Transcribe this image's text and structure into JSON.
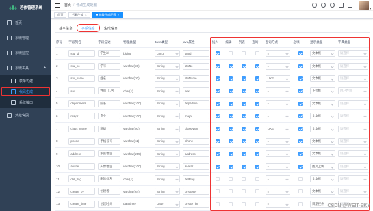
{
  "app": {
    "title": "若依管理系统"
  },
  "sidebar": {
    "items": [
      {
        "label": "首页",
        "icon": "dashboard-icon"
      },
      {
        "label": "系统管理",
        "icon": "system-icon"
      },
      {
        "label": "系统监控",
        "icon": "monitor-icon"
      },
      {
        "label": "系统工具",
        "icon": "tool-icon",
        "open": true,
        "children": [
          {
            "label": "表单构建",
            "icon": "build-icon"
          },
          {
            "label": "代码生成",
            "icon": "code-icon",
            "active": true
          },
          {
            "label": "系统接口",
            "icon": "swagger-icon"
          }
        ]
      },
      {
        "label": "若依官网",
        "icon": "guide-icon"
      }
    ]
  },
  "breadcrumb": {
    "home": "首页",
    "sep": "/",
    "current": "修改生成配置"
  },
  "tags": [
    {
      "label": "首页"
    },
    {
      "label": "代码生成",
      "closable": true
    },
    {
      "label": "修改生成配置",
      "closable": true,
      "active": true
    }
  ],
  "tabs": [
    {
      "label": "基本信息"
    },
    {
      "label": "字段信息",
      "active": true
    },
    {
      "label": "生成信息"
    }
  ],
  "table": {
    "headers": [
      "序号",
      "字段列名",
      "字段描述",
      "物理类型",
      "Java类型",
      "java属性",
      "插入",
      "编辑",
      "列表",
      "查询",
      "查询方式",
      "必填",
      "显示类型",
      "字典类型"
    ],
    "rows": [
      [
        "1",
        "stu_id",
        "学生id",
        "bigint",
        "Long",
        "stuId",
        true,
        false,
        false,
        false,
        "=",
        true,
        "文本框",
        "请选择"
      ],
      [
        "2",
        "stu_no",
        "学号",
        "varchar(30)",
        "String",
        "stuNo",
        true,
        true,
        true,
        true,
        "=",
        true,
        "文本框",
        "请选择"
      ],
      [
        "3",
        "stu_name",
        "姓名",
        "varchar(30)",
        "String",
        "stuName",
        true,
        true,
        true,
        true,
        "LIKE",
        true,
        "文本框",
        "请选择"
      ],
      [
        "4",
        "sex",
        "性别（1男",
        "char(1)",
        "String",
        "sex",
        true,
        true,
        true,
        true,
        "=",
        true,
        "下拉框",
        "用户性别"
      ],
      [
        "5",
        "department",
        "院系",
        "varchar(100)",
        "String",
        "departme",
        true,
        true,
        true,
        true,
        "=",
        true,
        "文本框",
        "请选择"
      ],
      [
        "6",
        "major",
        "专业",
        "varchar(100)",
        "String",
        "major",
        true,
        true,
        true,
        true,
        "=",
        true,
        "文本框",
        "请选择"
      ],
      [
        "7",
        "class_name",
        "班级",
        "varchar(50)",
        "String",
        "classNam",
        true,
        true,
        true,
        true,
        "LIKE",
        true,
        "文本框",
        "请选择"
      ],
      [
        "8",
        "phone",
        "手机号码",
        "varchar(11)",
        "String",
        "phone",
        true,
        true,
        true,
        true,
        "=",
        true,
        "文本框",
        "请选择"
      ],
      [
        "9",
        "address",
        "家庭地址",
        "varchar(255)",
        "String",
        "address",
        true,
        true,
        true,
        true,
        "=",
        true,
        "文本框",
        "请选择"
      ],
      [
        "10",
        "avatar",
        "头像地址",
        "varchar(100)",
        "String",
        "avatar",
        true,
        true,
        true,
        true,
        "=",
        true,
        "图片上传",
        "请选择"
      ],
      [
        "11",
        "del_flag",
        "删除标志",
        "char(1)",
        "String",
        "delFlag",
        false,
        false,
        false,
        false,
        "=",
        false,
        "文本框",
        "请选择"
      ],
      [
        "12",
        "create_by",
        "创建者",
        "varchar(64)",
        "String",
        "createBy",
        false,
        false,
        false,
        false,
        "=",
        false,
        "文本框",
        "请选择"
      ],
      [
        "13",
        "create_time",
        "创建时间",
        "datetime",
        "Date",
        "createTim",
        false,
        false,
        false,
        false,
        "=",
        false,
        "日期控件",
        "请选择"
      ]
    ]
  },
  "watermark": "CSDN @WEIT-SKY",
  "colors": {
    "sidebar": "#304156",
    "accent": "#409eff",
    "highlight": "#e33333"
  }
}
